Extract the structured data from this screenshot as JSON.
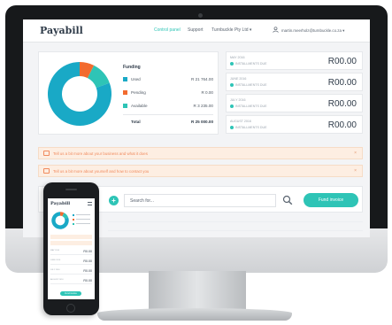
{
  "brand": {
    "logo": "Payabill",
    "accent": "#2ec4b6",
    "dark": "#2f3b49",
    "warning": "#f08a5d"
  },
  "header": {
    "nav": [
      "Control panel",
      "Support",
      "Turnbuckle Pty Ltd ▾"
    ],
    "user_email": "martin.meerholz@turnbuckle.co.za ▾",
    "user_icon": "user-icon"
  },
  "funding": {
    "title": "Funding",
    "rows": [
      {
        "label": "Used",
        "value": "R 21 764.00",
        "color": "#19a9c6"
      },
      {
        "label": "Pending",
        "value": "R 0.00",
        "color": "#f26b2f"
      },
      {
        "label": "Available",
        "value": "R 3 235.00",
        "color": "#2ec4b6"
      }
    ],
    "total": {
      "label": "Total",
      "value": "R 25 000.00"
    },
    "chart": {
      "used": 21764,
      "pending": 2000,
      "available": 3235
    }
  },
  "installments": [
    {
      "month": "MAY 2016",
      "sub": "INSTALLMENTS DUE",
      "amount": "R00.00"
    },
    {
      "month": "JUNE 2016",
      "sub": "INSTALLMENTS DUE",
      "amount": "R00.00"
    },
    {
      "month": "JULY 2016",
      "sub": "INSTALLMENTS DUE",
      "amount": "R00.00"
    },
    {
      "month": "AUGUST 2016",
      "sub": "INSTALLMENTS DUE",
      "amount": "R00.00"
    }
  ],
  "alerts": [
    {
      "text": "Tell us a bit more about your business and what it does",
      "close": "×"
    },
    {
      "text": "Tell us a bit more about yourself and how to contact you",
      "close": "×"
    }
  ],
  "search": {
    "placeholder": "Search for...",
    "add_label": "+",
    "button_label": "Fund invoice",
    "search_icon": "search-icon"
  },
  "phone": {
    "logo": "Payabill",
    "rows": [
      {
        "month": "MAY 2016",
        "value": "R0.00"
      },
      {
        "month": "JUNE 2016",
        "value": "R0.00"
      },
      {
        "month": "JULY 2016",
        "value": "R0.00"
      },
      {
        "month": "AUGUST 2016",
        "value": "R0.00"
      }
    ],
    "button_label": "Fund invoice"
  }
}
